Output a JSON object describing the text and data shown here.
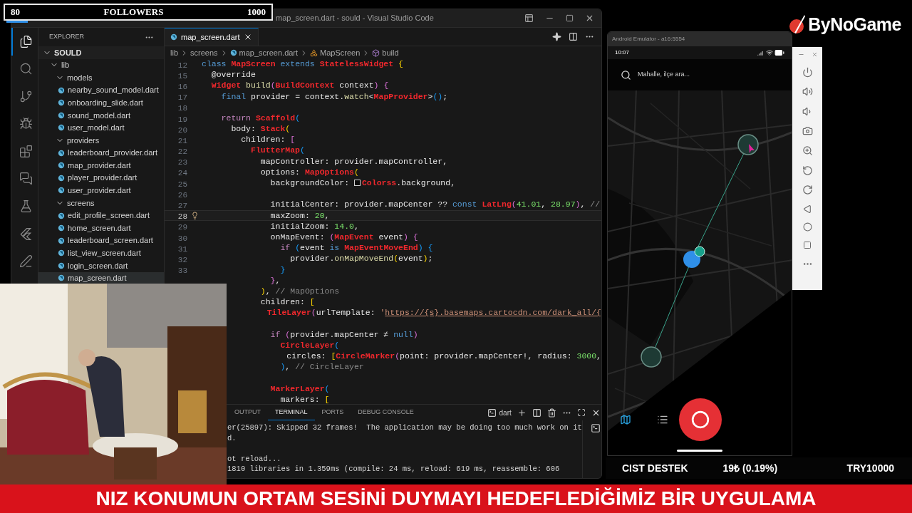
{
  "followers_bar": {
    "current": "80",
    "label": "FOLLOWERS",
    "goal": "1000",
    "level": 0.08
  },
  "logo": {
    "text": "ByNoGame"
  },
  "vscode": {
    "title": "map_screen.dart - sould - Visual Studio Code",
    "activity_bar": [
      {
        "kind": "files",
        "selected": true
      },
      {
        "kind": "search",
        "selected": false
      },
      {
        "kind": "source_control",
        "selected": false
      },
      {
        "kind": "run",
        "selected": false
      },
      {
        "kind": "extensions",
        "selected": false
      },
      {
        "kind": "chat",
        "selected": false
      },
      {
        "kind": "testing",
        "selected": false
      },
      {
        "kind": "flutter",
        "selected": false
      },
      {
        "kind": "edit",
        "selected": false
      }
    ],
    "explorer": {
      "title": "EXPLORER",
      "tree": [
        {
          "label": "SOULD",
          "kind": "root",
          "expanded": true,
          "selected": false,
          "children": [
            {
              "label": "lib",
              "kind": "folder",
              "expanded": true,
              "selected": false,
              "children": [
                {
                  "label": "models",
                  "kind": "folder",
                  "expanded": true,
                  "selected": false,
                  "children": [
                    {
                      "label": "nearby_sound_model.dart",
                      "kind": "file",
                      "selected": false
                    },
                    {
                      "label": "onboarding_slide.dart",
                      "kind": "file",
                      "selected": false
                    },
                    {
                      "label": "sound_model.dart",
                      "kind": "file",
                      "selected": false
                    },
                    {
                      "label": "user_model.dart",
                      "kind": "file",
                      "selected": false
                    }
                  ]
                },
                {
                  "label": "providers",
                  "kind": "folder",
                  "expanded": true,
                  "selected": false,
                  "children": [
                    {
                      "label": "leaderboard_provider.dart",
                      "kind": "file",
                      "selected": false
                    },
                    {
                      "label": "map_provider.dart",
                      "kind": "file",
                      "selected": false
                    },
                    {
                      "label": "player_provider.dart",
                      "kind": "file",
                      "selected": false
                    },
                    {
                      "label": "user_provider.dart",
                      "kind": "file",
                      "selected": false
                    }
                  ]
                },
                {
                  "label": "screens",
                  "kind": "folder",
                  "expanded": true,
                  "selected": false,
                  "children": [
                    {
                      "label": "edit_profile_screen.dart",
                      "kind": "file",
                      "selected": false
                    },
                    {
                      "label": "home_screen.dart",
                      "kind": "file",
                      "selected": false
                    },
                    {
                      "label": "leaderboard_screen.dart",
                      "kind": "file",
                      "selected": false
                    },
                    {
                      "label": "list_view_screen.dart",
                      "kind": "file",
                      "selected": false
                    },
                    {
                      "label": "login_screen.dart",
                      "kind": "file",
                      "selected": false
                    },
                    {
                      "label": "map_screen.dart",
                      "kind": "file",
                      "selected": true
                    }
                  ]
                }
              ]
            }
          ]
        }
      ]
    },
    "tabs": [
      {
        "label": "map_screen.dart",
        "selected": true
      }
    ],
    "breadcrumbs": [
      {
        "label": "lib",
        "kind": "folder"
      },
      {
        "label": "screens",
        "kind": "folder"
      },
      {
        "label": "map_screen.dart",
        "kind": "file"
      },
      {
        "label": "MapScreen",
        "kind": "class"
      },
      {
        "label": "build",
        "kind": "method"
      }
    ],
    "code": [
      {
        "number": "12",
        "current": false,
        "tokens": [
          {
            "kind": "kw",
            "text": "class"
          },
          {
            "kind": "type",
            "text": " MapScreen"
          },
          {
            "kind": "kw",
            "text": " extends"
          },
          {
            "kind": "type",
            "text": " StatelessWidget"
          },
          {
            "kind": "p1",
            "text": " {"
          }
        ]
      },
      {
        "number": "15",
        "current": false,
        "tokens": [
          {
            "kind": "plain",
            "text": "  @override"
          }
        ]
      },
      {
        "number": "16",
        "current": false,
        "tokens": [
          {
            "kind": "type",
            "text": "  Widget"
          },
          {
            "kind": "fn",
            "text": " build"
          },
          {
            "kind": "p2",
            "text": "("
          },
          {
            "kind": "type",
            "text": "BuildContext"
          },
          {
            "kind": "plain",
            "text": " context"
          },
          {
            "kind": "p2",
            "text": ")"
          },
          {
            "kind": "p2",
            "text": " {"
          }
        ]
      },
      {
        "number": "17",
        "current": false,
        "tokens": [
          {
            "kind": "kw",
            "text": "    final"
          },
          {
            "kind": "plain",
            "text": " provider = context."
          },
          {
            "kind": "fn",
            "text": "watch"
          },
          {
            "kind": "plain",
            "text": "<"
          },
          {
            "kind": "type",
            "text": "MapProvider"
          },
          {
            "kind": "plain",
            "text": ">"
          },
          {
            "kind": "p3",
            "text": "()"
          },
          {
            "kind": "plain",
            "text": ";"
          }
        ]
      },
      {
        "number": "18",
        "current": false
      },
      {
        "number": "19",
        "current": false,
        "tokens": [
          {
            "kind": "ctl",
            "text": "    return"
          },
          {
            "kind": "type",
            "text": " Scaffold"
          },
          {
            "kind": "p3",
            "text": "("
          }
        ]
      },
      {
        "number": "20",
        "current": false,
        "tokens": [
          {
            "kind": "plain",
            "text": "      body: "
          },
          {
            "kind": "type",
            "text": "Stack"
          },
          {
            "kind": "p1",
            "text": "("
          }
        ]
      },
      {
        "number": "21",
        "current": false,
        "tokens": [
          {
            "kind": "plain",
            "text": "        children: "
          },
          {
            "kind": "p2",
            "text": "["
          }
        ]
      },
      {
        "number": "22",
        "current": false,
        "tokens": [
          {
            "kind": "type",
            "text": "          FlutterMap"
          },
          {
            "kind": "p3",
            "text": "("
          }
        ]
      },
      {
        "number": "23",
        "current": false,
        "tokens": [
          {
            "kind": "plain",
            "text": "            mapController: provider.mapController,"
          }
        ]
      },
      {
        "number": "24",
        "current": false,
        "tokens": [
          {
            "kind": "plain",
            "text": "            options: "
          },
          {
            "kind": "type",
            "text": "MapOptions"
          },
          {
            "kind": "p1",
            "text": "("
          }
        ]
      },
      {
        "number": "25",
        "current": false,
        "tokens": [
          {
            "kind": "plain",
            "text": "              backgroundColor: "
          },
          {
            "kind": "swatch"
          },
          {
            "kind": "type",
            "text": "Colorss"
          },
          {
            "kind": "plain",
            "text": ".background,"
          }
        ]
      },
      {
        "number": "26",
        "current": false
      },
      {
        "number": "27",
        "current": false,
        "tokens": [
          {
            "kind": "plain",
            "text": "              initialCenter: provider.mapCenter ?? "
          },
          {
            "kind": "kw",
            "text": "const"
          },
          {
            "kind": "type",
            "text": " LatLng"
          },
          {
            "kind": "p2",
            "text": "("
          },
          {
            "kind": "num",
            "text": "41.01"
          },
          {
            "kind": "plain",
            "text": ", "
          },
          {
            "kind": "num",
            "text": "28.97"
          },
          {
            "kind": "p2",
            "text": ")"
          },
          {
            "kind": "plain",
            "text": ", "
          },
          {
            "kind": "cmt",
            "text": "//"
          }
        ]
      },
      {
        "number": "28",
        "current": true,
        "tokens": [
          {
            "kind": "plain",
            "text": "              maxZoom: "
          },
          {
            "kind": "num",
            "text": "20"
          },
          {
            "kind": "plain",
            "text": ","
          }
        ]
      },
      {
        "number": "29",
        "current": false,
        "tokens": [
          {
            "kind": "plain",
            "text": "              initialZoom: "
          },
          {
            "kind": "num",
            "text": "14.0"
          },
          {
            "kind": "plain",
            "text": ","
          }
        ]
      },
      {
        "number": "30",
        "current": false,
        "tokens": [
          {
            "kind": "plain",
            "text": "              onMapEvent: "
          },
          {
            "kind": "p2",
            "text": "("
          },
          {
            "kind": "type",
            "text": "MapEvent"
          },
          {
            "kind": "plain",
            "text": " event"
          },
          {
            "kind": "p2",
            "text": ")"
          },
          {
            "kind": "p2",
            "text": " {"
          }
        ]
      },
      {
        "number": "31",
        "current": false,
        "tokens": [
          {
            "kind": "ctl",
            "text": "                if"
          },
          {
            "kind": "p3",
            "text": " ("
          },
          {
            "kind": "plain",
            "text": "event "
          },
          {
            "kind": "kw",
            "text": "is"
          },
          {
            "kind": "type",
            "text": " MapEventMoveEnd"
          },
          {
            "kind": "p3",
            "text": ")"
          },
          {
            "kind": "p3",
            "text": " {"
          }
        ]
      },
      {
        "number": "32",
        "current": false,
        "tokens": [
          {
            "kind": "plain",
            "text": "                  provider."
          },
          {
            "kind": "fn",
            "text": "onMapMoveEnd"
          },
          {
            "kind": "p1",
            "text": "("
          },
          {
            "kind": "plain",
            "text": "event"
          },
          {
            "kind": "p1",
            "text": ")"
          },
          {
            "kind": "plain",
            "text": ";"
          }
        ]
      },
      {
        "number": "33",
        "current": false,
        "tokens": [
          {
            "kind": "p3",
            "text": "                }"
          }
        ]
      },
      {
        "current": false,
        "tokens": [
          {
            "kind": "p2",
            "text": "              }"
          },
          {
            "kind": "plain",
            "text": ","
          }
        ]
      },
      {
        "current": false,
        "tokens": [
          {
            "kind": "p1",
            "text": "            )"
          },
          {
            "kind": "plain",
            "text": ", "
          },
          {
            "kind": "cmt",
            "text": "// MapOptions"
          }
        ]
      },
      {
        "current": false,
        "tokens": [
          {
            "kind": "plain",
            "text": "            children: "
          },
          {
            "kind": "p1",
            "text": "["
          }
        ]
      },
      {
        "current": false,
        "tokens": [
          {
            "kind": "type",
            "text": "              TileLayer"
          },
          {
            "kind": "p2",
            "text": "("
          },
          {
            "kind": "plain",
            "text": "urlTemplate: "
          },
          {
            "kind": "str",
            "text": "'"
          },
          {
            "kind": "link",
            "text": "https://{s}.basemaps.cartocdn.com/dark_all/{"
          }
        ]
      },
      {
        "current": false
      },
      {
        "current": false,
        "tokens": [
          {
            "kind": "ctl",
            "text": "              if"
          },
          {
            "kind": "p2",
            "text": " ("
          },
          {
            "kind": "plain",
            "text": "provider.mapCenter ≠ "
          },
          {
            "kind": "kw",
            "text": "null"
          },
          {
            "kind": "p2",
            "text": ")"
          }
        ]
      },
      {
        "current": false,
        "tokens": [
          {
            "kind": "type",
            "text": "                CircleLayer"
          },
          {
            "kind": "p3",
            "text": "("
          }
        ]
      },
      {
        "current": false,
        "tokens": [
          {
            "kind": "plain",
            "text": "                  circles: "
          },
          {
            "kind": "p1",
            "text": "["
          },
          {
            "kind": "type",
            "text": "CircleMarker"
          },
          {
            "kind": "p2",
            "text": "("
          },
          {
            "kind": "plain",
            "text": "point: provider.mapCenter!, radius: "
          },
          {
            "kind": "num",
            "text": "3000"
          },
          {
            "kind": "plain",
            "text": ","
          }
        ]
      },
      {
        "current": false,
        "tokens": [
          {
            "kind": "p3",
            "text": "                )"
          },
          {
            "kind": "plain",
            "text": ", "
          },
          {
            "kind": "cmt",
            "text": "// CircleLayer"
          }
        ]
      },
      {
        "current": false
      },
      {
        "current": false,
        "tokens": [
          {
            "kind": "type",
            "text": "              MarkerLayer"
          },
          {
            "kind": "p3",
            "text": "("
          }
        ]
      },
      {
        "current": false,
        "tokens": [
          {
            "kind": "plain",
            "text": "                markers: "
          },
          {
            "kind": "p1",
            "text": "["
          }
        ]
      }
    ],
    "panel": {
      "tabs": [
        {
          "label": "OUTPUT",
          "selected": false
        },
        {
          "label": "TERMINAL",
          "selected": true
        },
        {
          "label": "PORTS",
          "selected": false
        },
        {
          "label": "DEBUG CONSOLE",
          "selected": false
        }
      ],
      "terminal_name": "dart",
      "terminal_lines": [
        {
          "text": "er(25897): Skipped 32 frames!  The application may be doing too much work on it",
          "blank_before": false
        },
        {
          "text": "d.",
          "blank_before": false
        },
        {
          "text": "ot reload...",
          "blank_before": true
        },
        {
          "text": "1810 libraries in 1.359ms (compile: 24 ms, reload: 619 ms, reassemble: 606",
          "blank_before": false
        }
      ]
    }
  },
  "emulator": {
    "title": "Android Emulator - a16:5554",
    "time": "10:07",
    "search_placeholder": "Mahalle, ilçe ara...",
    "nav_items": [
      {
        "kind": "map",
        "selected": true
      },
      {
        "kind": "list",
        "selected": false
      }
    ]
  },
  "donation_bar": {
    "label": "CIST DESTEK",
    "raised": "19₺ (0.19%)",
    "goal": "TRY10000"
  },
  "ticker": {
    "text": "NIZ KONUMUN ORTAM SESİNİ DUYMAYI HEDEFLEDİĞİMİZ BİR UYGULAMA"
  }
}
